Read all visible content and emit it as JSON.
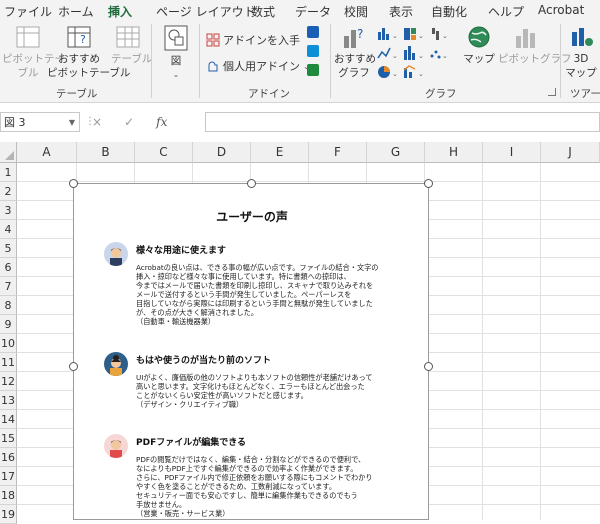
{
  "menu": {
    "tabs": [
      "ファイル",
      "ホーム",
      "挿入",
      "ページ レイアウト",
      "数式",
      "データ",
      "校閲",
      "表示",
      "自動化",
      "ヘルプ",
      "Acrobat"
    ],
    "active": "挿入"
  },
  "ribbon": {
    "table_group": {
      "pivot_label1": "ピボットテー",
      "pivot_label2": "ブル",
      "recommended_label1": "おすすめ",
      "recommended_label2": "ピボットテーブル",
      "table_label": "テーブル",
      "group_label": "テーブル"
    },
    "illust_label": "図",
    "addin_group": {
      "get_addins": "アドインを入手",
      "my_addins": "個人用アドイン",
      "group_label": "アドイン"
    },
    "chart_group": {
      "recommended_label1": "おすすめ",
      "recommended_label2": "グラフ",
      "map_label": "マップ",
      "pivot_chart_label": "ピボットグラフ",
      "group_label": "グラフ"
    },
    "tour_group": {
      "label1": "3D",
      "label2": "マップ",
      "group_label": "ツアー"
    }
  },
  "formula_bar": {
    "name_box": "図 3",
    "cancel": "×",
    "enter": "✓",
    "fx": "fx",
    "value": ""
  },
  "columns": [
    "A",
    "B",
    "C",
    "D",
    "E",
    "F",
    "G",
    "H",
    "I",
    "J"
  ],
  "rows": [
    "1",
    "2",
    "3",
    "4",
    "5",
    "6",
    "7",
    "8",
    "9",
    "10",
    "11",
    "12",
    "13",
    "14",
    "15",
    "16",
    "17",
    "18",
    "19"
  ],
  "document": {
    "title": "ユーザーの声",
    "sections": [
      {
        "heading": "様々な用途に使えます",
        "lines": [
          "Acrobatの良い点は、できる事の幅が広い点です。ファイルの結合・文字の",
          "挿入・掠印など様々な事に使用しています。特に書類への掠印は、",
          "今まではメールで届いた書類を印刷し掠印し、スキャナで取り込みそれを",
          "メールで送付するという手間が発生していました。ペーパーレスを",
          "目指していながら実際には印刷するという手間と無駄が発生していました",
          "が、その点が大きく解消されました。",
          "（自動車・輸送機器業）"
        ]
      },
      {
        "heading": "もはや使うのが当たり前のソフト",
        "lines": [
          "UIがよく、廉価版の他のソフトよりも本ソフトの信頼性が老舗だけあって",
          "高いと思います。文字化けもほとんどなく、エラーもほとんど出会った",
          "ことがないくらい安定性が高いソフトだと感じます。",
          "（デザイン・クリエイティブ職）"
        ]
      },
      {
        "heading": "PDFファイルが編集できる",
        "lines": [
          "PDFの閲覧だけではなく、編集・結合・分割などができるので便利で、",
          "なによりもPDF上ですぐ編集ができるので効率よく作業ができます。",
          "さらに、PDFファイル内で修正依頼をお願いする際にもコメントでわかり",
          "やすく色を塗ることができるため、工数削減になっています。",
          "セキュリティー面でも安心ですし、簡単に編集作業もできるのでもう",
          "手放せません。",
          "（営業・販売・サービス業）"
        ]
      }
    ]
  },
  "colors": {
    "accent": "#1e6b3c",
    "handle_border": "#555555",
    "header_bg": "#f0f0f0"
  }
}
